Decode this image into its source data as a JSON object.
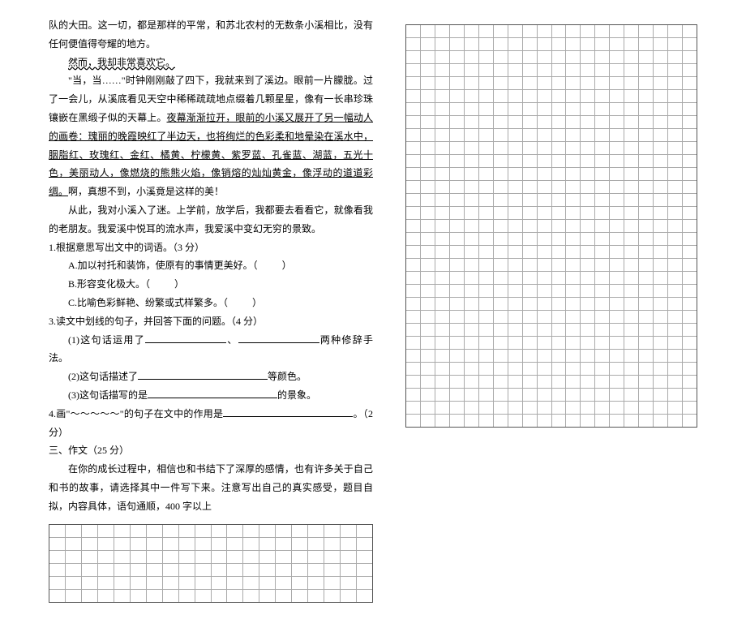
{
  "passage": {
    "p1_continued": "队的大田。这一切，都是那样的平常，和苏北农村的无数条小溪相比，没有任何便值得夸耀的地方。",
    "p2": "然而，我却非常喜欢它。",
    "p3_a": "\"当，当……\"时钟刚刚敲了四下，我就来到了溪边。眼前一片朦胧。过了一会儿，从溪底看见天空中稀稀疏疏地点缀着几颗星星，像有一长串珍珠镶嵌在黑缎子似的天幕上。",
    "p3_b": "夜幕渐渐拉开，眼前的小溪又展开了另一幅动人的画卷：瑰丽的晚霞映红了半边天，也将绚烂的色彩柔和地晕染在溪水中，胭脂红、玫瑰红、金红、橘黄、柠檬黄、紫罗蓝、孔雀蓝、湖蓝，五光十色，美丽动人，像燃烧的熊熊火焰，像销熔的灿灿黄金，像浮动的道道彩绸。",
    "p3_c": "啊，真想不到，小溪竟是这样的美！",
    "p4": "从此，我对小溪入了迷。上学前，放学后，我都要去看看它，就像看我的老朋友。我爱溪中悦耳的流水声，我爱溪中变幻无穷的景致。"
  },
  "questions": {
    "q1_title": "1.根据意思写出文中的词语。（3 分）",
    "q1_a": "A.加以衬托和装饰，使原有的事情更美好。（",
    "q1_b": "B.形容变化极大。（",
    "q1_c": "C.比喻色彩鲜艳、纷繁或式样繁多。（",
    "q1_close": "）",
    "q3_title": "3.读文中划线的句子，并回答下面的问题。（4 分）",
    "q3_1a": "(1)这句话运用了",
    "q3_1b": "、",
    "q3_1c": "两种修辞手法。",
    "q3_2a": "(2)这句话描述了",
    "q3_2b": "等颜色。",
    "q3_3a": "(3)这句话描写的是",
    "q3_3b": "的景象。",
    "q4a": "4.画\"～～～～～\"的句子在文中的作用是",
    "q4b": "。（2 分）"
  },
  "writing": {
    "section": "三、作文（25 分）",
    "prompt": "在你的成长过程中，相信也和书结下了深厚的感情，也有许多关于自己和书的故事，请选择其中一件写下来。注意写出自己的真实感受，题目自拟，内容具体，语句通顺，400 字以上"
  },
  "grids": {
    "left_rows": 6,
    "left_cols": 20,
    "right_rows": 31,
    "right_cols": 20
  }
}
